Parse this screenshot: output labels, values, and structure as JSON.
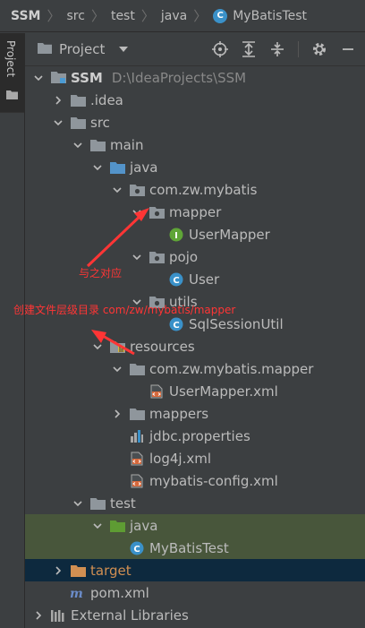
{
  "breadcrumb": [
    "SSM",
    "src",
    "test",
    "java",
    "MyBatisTest"
  ],
  "side_tab": {
    "label": "Project"
  },
  "panel": {
    "title": "Project"
  },
  "tree": [
    {
      "depth": 0,
      "arrow": "down",
      "icon": "module",
      "label": "SSM",
      "bold": true,
      "path": "D:\\IdeaProjects\\SSM"
    },
    {
      "depth": 1,
      "arrow": "right",
      "icon": "folder",
      "label": ".idea"
    },
    {
      "depth": 1,
      "arrow": "down",
      "icon": "folder",
      "label": "src"
    },
    {
      "depth": 2,
      "arrow": "down",
      "icon": "folder",
      "label": "main"
    },
    {
      "depth": 3,
      "arrow": "down",
      "icon": "src-folder",
      "label": "java"
    },
    {
      "depth": 4,
      "arrow": "down",
      "icon": "package",
      "label": "com.zw.mybatis"
    },
    {
      "depth": 5,
      "arrow": "down",
      "icon": "package",
      "label": "mapper"
    },
    {
      "depth": 6,
      "arrow": "none",
      "icon": "interface",
      "label": "UserMapper"
    },
    {
      "depth": 5,
      "arrow": "down",
      "icon": "package",
      "label": "pojo"
    },
    {
      "depth": 6,
      "arrow": "none",
      "icon": "class",
      "label": "User"
    },
    {
      "depth": 5,
      "arrow": "down",
      "icon": "package",
      "label": "utils"
    },
    {
      "depth": 6,
      "arrow": "none",
      "icon": "class",
      "label": "SqlSessionUtil"
    },
    {
      "depth": 3,
      "arrow": "down",
      "icon": "res-folder",
      "label": "resources"
    },
    {
      "depth": 4,
      "arrow": "down",
      "icon": "folder",
      "label": "com.zw.mybatis.mapper"
    },
    {
      "depth": 5,
      "arrow": "none",
      "icon": "xml",
      "label": "UserMapper.xml"
    },
    {
      "depth": 4,
      "arrow": "right",
      "icon": "folder",
      "label": "mappers"
    },
    {
      "depth": 4,
      "arrow": "none",
      "icon": "properties",
      "label": "jdbc.properties"
    },
    {
      "depth": 4,
      "arrow": "none",
      "icon": "xml",
      "label": "log4j.xml"
    },
    {
      "depth": 4,
      "arrow": "none",
      "icon": "xml",
      "label": "mybatis-config.xml"
    },
    {
      "depth": 2,
      "arrow": "down",
      "icon": "folder",
      "label": "test"
    },
    {
      "depth": 3,
      "arrow": "down",
      "icon": "test-folder",
      "label": "java",
      "selected": "green"
    },
    {
      "depth": 4,
      "arrow": "none",
      "icon": "class",
      "label": "MyBatisTest",
      "selected": "green"
    },
    {
      "depth": 1,
      "arrow": "right",
      "icon": "excluded",
      "label": "target",
      "selected": "blue"
    },
    {
      "depth": 1,
      "arrow": "none",
      "icon": "maven",
      "label": "pom.xml"
    },
    {
      "depth": 0,
      "arrow": "right",
      "icon": "library",
      "label": "External Libraries"
    }
  ],
  "annotations": [
    {
      "text": "与之对应"
    },
    {
      "text": "创建文件层级目录 com/zw/mybatis/mapper"
    }
  ],
  "colors": {
    "background": "#3c3f41",
    "annotation": "#ff3535",
    "selected_green": "#48563b",
    "selected_blue": "#0d293e",
    "class_icon": "#3a91c9",
    "interface_icon": "#5fa537",
    "src_folder": "#5393c9",
    "test_folder": "#5e9c33",
    "excluded_folder": "#d18f52"
  }
}
